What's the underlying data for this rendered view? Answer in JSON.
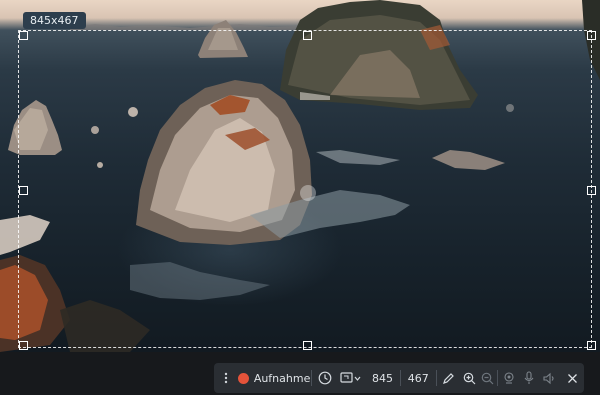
{
  "capture": {
    "size_label": "845x467"
  },
  "toolbar": {
    "record_label": "Aufnahme",
    "width_value": "845",
    "height_value": "467",
    "colors": {
      "record": "#e5533a",
      "toolbar_bg": "#2a2e33",
      "badge_bg": "#2d3e4d"
    }
  },
  "icons": [
    "drag-handle-icon",
    "record-dot-icon",
    "clock-icon",
    "display-dropdown-icon",
    "pen-icon",
    "zoom-in-icon",
    "zoom-out-icon",
    "webcam-icon",
    "microphone-icon",
    "speaker-icon",
    "close-icon"
  ]
}
